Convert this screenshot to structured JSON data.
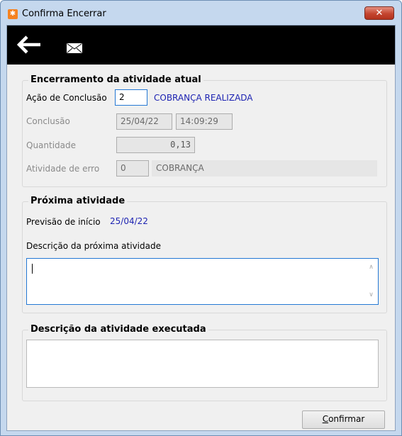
{
  "window": {
    "title": "Confirma Encerrar",
    "close_symbol": "✕"
  },
  "toolbar": {
    "back_icon": "arrow-left-icon",
    "mail_icon": "envelope-icon"
  },
  "closing_section": {
    "title": "Encerramento da atividade atual",
    "acao_label": "Ação de Conclusão",
    "acao_code": "2",
    "acao_description": "COBRANÇA REALIZADA",
    "conclusao_label": "Conclusão",
    "conclusao_date": "25/04/22",
    "conclusao_time": "14:09:29",
    "quantidade_label": "Quantidade",
    "quantidade_value": "0,13",
    "erro_label": "Atividade de erro",
    "erro_code": "0",
    "erro_description": "COBRANÇA"
  },
  "next_section": {
    "title": "Próxima atividade",
    "previsao_label": "Previsão de início",
    "previsao_value": "25/04/22",
    "descricao_label": "Descrição da próxima atividade",
    "descricao_value": ""
  },
  "executed_section": {
    "title": "Descrição da atividade executada",
    "value": ""
  },
  "footer": {
    "confirm_first": "C",
    "confirm_rest": "onfirmar"
  },
  "colors": {
    "link_blue": "#1d23b2",
    "toolbar": "#000000",
    "focus_border": "#2478d4"
  }
}
